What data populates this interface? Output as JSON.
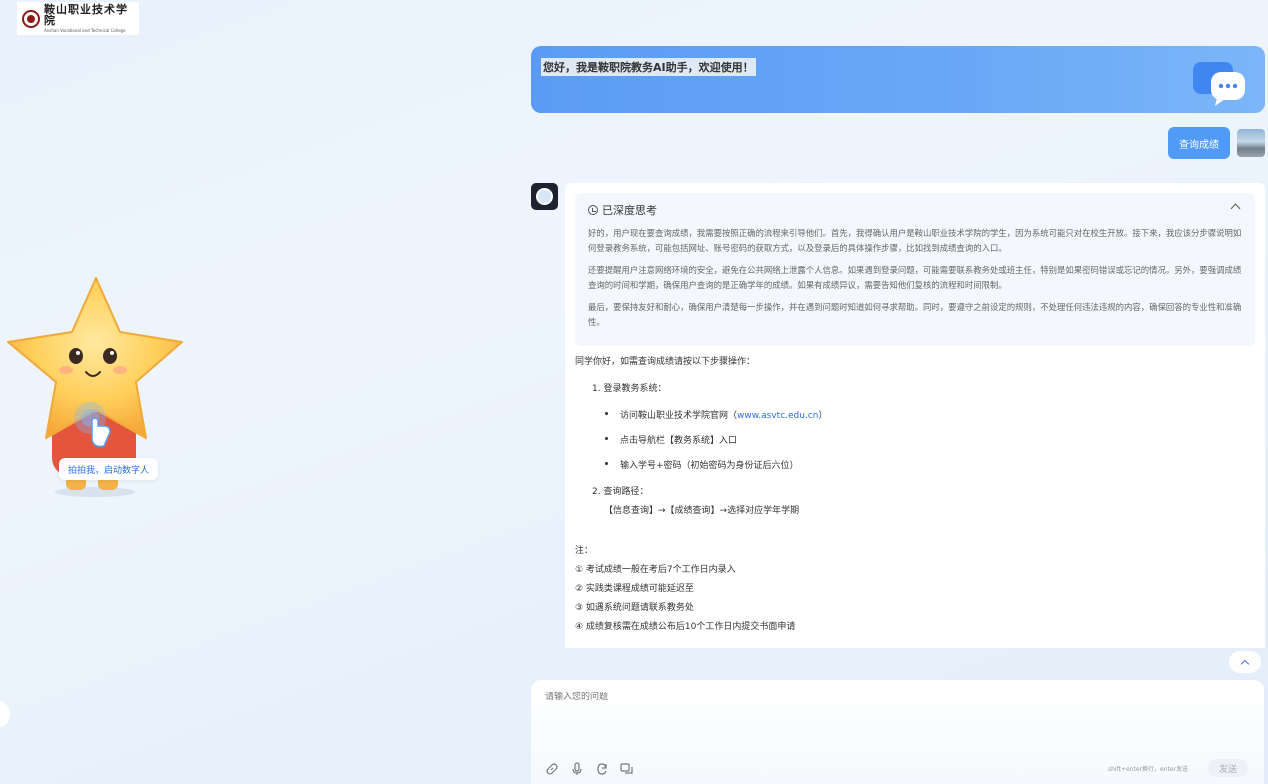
{
  "logo": {
    "name_cn": "鞍山职业技术学院",
    "name_en": "Anshan Vocational and Technical College"
  },
  "mascot": {
    "hint": "拍拍我，启动数字人"
  },
  "greeting": {
    "text": "您好，我是鞍职院教务AI助手，欢迎使用！"
  },
  "user_message": {
    "text": "查询成绩"
  },
  "thinking": {
    "title": "已深度思考",
    "paragraphs": [
      "好的，用户现在要查询成绩，我需要按照正确的流程来引导他们。首先，我得确认用户是鞍山职业技术学院的学生，因为系统可能只对在校生开放。接下来，我应该分步骤说明如何登录教务系统，可能包括网址、账号密码的获取方式，以及登录后的具体操作步骤，比如找到成绩查询的入口。",
      "还要提醒用户注意网络环境的安全，避免在公共网络上泄露个人信息。如果遇到登录问题，可能需要联系教务处或班主任，特别是如果密码错误或忘记的情况。另外，要强调成绩查询的时间和学期，确保用户查询的是正确学年的成绩。如果有成绩异议，需要告知他们复核的流程和时间限制。",
      "最后，要保持友好和耐心，确保用户清楚每一步操作，并在遇到问题时知道如何寻求帮助。同时，要遵守之前设定的规则，不处理任何违法违规的内容，确保回答的专业性和准确性。"
    ]
  },
  "reply": {
    "intro": "同学你好，如需查询成绩请按以下步骤操作：",
    "step1_title": "1. 登录教务系统：",
    "step1_items": {
      "item1_prefix": "访问鞍山职业技术学院官网（",
      "item1_link": "www.asvtc.edu.cn",
      "item1_suffix": "）",
      "item2": "点击导航栏【教务系统】入口",
      "item3": "输入学号+密码（初始密码为身份证后六位）"
    },
    "step2_title": "2. 查询路径：",
    "step2_path": "【信息查询】→【成绩查询】→选择对应学年学期",
    "notes_title": "注：",
    "notes": [
      "① 考试成绩一般在考后7个工作日内录入",
      "② 实践类课程成绩可能延迟至",
      "③ 如遇系统问题请联系教务处",
      "④ 成绩复核需在成绩公布后10个工作日内提交书面申请"
    ]
  },
  "composer": {
    "placeholder": "请输入您的问题",
    "hint": "shift+enter换行，enter发送",
    "send_label": "发送"
  },
  "colors": {
    "accent": "#4f9bf6",
    "link": "#2c6fdc"
  }
}
